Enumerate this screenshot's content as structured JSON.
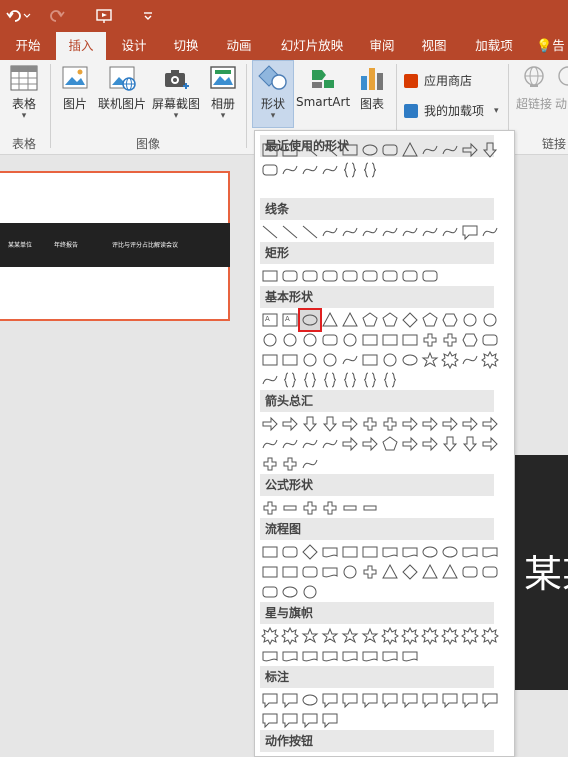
{
  "titlebar": {
    "undo_icon": "undo-icon",
    "redo_icon": "redo-icon",
    "present_icon": "slideshow-start-icon",
    "customize_icon": "customize-quick-access-icon"
  },
  "tabs": [
    {
      "label": "开始"
    },
    {
      "label": "插入"
    },
    {
      "label": "设计"
    },
    {
      "label": "切换"
    },
    {
      "label": "动画"
    },
    {
      "label": "幻灯片放映"
    },
    {
      "label": "审阅"
    },
    {
      "label": "视图"
    },
    {
      "label": "加载项"
    },
    {
      "label": "告"
    }
  ],
  "active_tab": "插入",
  "ribbon": {
    "table": {
      "label": "表格",
      "group": "表格"
    },
    "picture": {
      "label": "图片"
    },
    "online_picture": {
      "label": "联机图片"
    },
    "screenshot": {
      "label": "屏幕截图"
    },
    "album": {
      "label": "相册"
    },
    "images_group": "图像",
    "shapes": {
      "label": "形状"
    },
    "smartart": {
      "label": "SmartArt"
    },
    "chart": {
      "label": "图表"
    },
    "store": {
      "label": "应用商店"
    },
    "my_addins": {
      "label": "我的加载项"
    },
    "hyperlink": {
      "label": "超链接"
    },
    "action": {
      "label": "动"
    },
    "links_group": "链接"
  },
  "slide": {
    "band_texts": [
      "某某单位",
      "年终报告",
      "评比与评分占比解读会议"
    ],
    "big_text": "某某"
  },
  "shapes_panel": {
    "sections": [
      {
        "title": "最近使用的形状"
      },
      {
        "title": "线条"
      },
      {
        "title": "矩形"
      },
      {
        "title": "基本形状"
      },
      {
        "title": "箭头总汇"
      },
      {
        "title": "公式形状"
      },
      {
        "title": "流程图"
      },
      {
        "title": "星与旗帜"
      },
      {
        "title": "标注"
      },
      {
        "title": "动作按钮"
      }
    ],
    "highlighted_shape": "oval"
  },
  "colors": {
    "accent": "#b7472a",
    "selection": "#e02020"
  }
}
